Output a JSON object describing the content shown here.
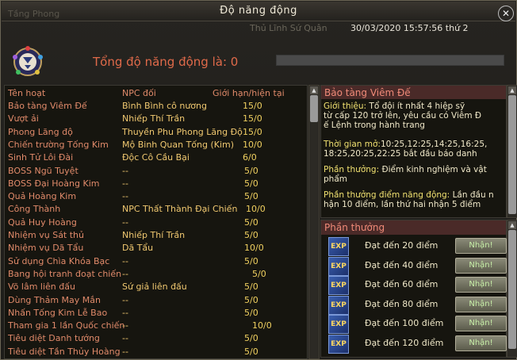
{
  "window": {
    "title": "Độ năng động",
    "ghost_left": "Tầng Phong",
    "ghost_right": "Thủ Lĩnh Sứ Quân",
    "datetime": "30/03/2020 15:57:56 thứ 2",
    "close_label": "✕"
  },
  "summary": {
    "total_label": "Tổng độ năng động là: 0",
    "progress": 0.0
  },
  "table": {
    "headers": [
      "Tên hoạt",
      "NPC đối",
      "Giới hạn/hiện tại"
    ],
    "rows": [
      {
        "name": "Bảo tàng Viêm Đế",
        "npc": "Bình Bình cô nương",
        "limit": "15/0"
      },
      {
        "name": "Vượt ải",
        "npc": "Nhiếp Thí Trần",
        "limit": "15/0"
      },
      {
        "name": "Phong Lăng độ",
        "npc": "Thuyền Phu Phong Lăng Độ",
        "limit": "15/0"
      },
      {
        "name": "Chiến trường Tống Kim",
        "npc": "Mộ Binh Quan Tống (Kim)",
        "limit": "10/0"
      },
      {
        "name": "Sinh Tử Lôi Đài",
        "npc": "Độc Cô Cầu Bại",
        "limit": "6/0"
      },
      {
        "name": "BOSS Ngũ Tuyệt",
        "npc": "--",
        "limit": "5/0"
      },
      {
        "name": "BOSS Đại Hoàng Kim",
        "npc": "--",
        "limit": "5/0"
      },
      {
        "name": "Quả Hoàng Kim",
        "npc": "--",
        "limit": "5/0"
      },
      {
        "name": "Công Thành",
        "npc": "NPC Thất Thành Đại Chiến",
        "limit": "10/0"
      },
      {
        "name": "Quả Huy Hoàng",
        "npc": "--",
        "limit": "5/0"
      },
      {
        "name": "Nhiệm vụ Sát thủ",
        "npc": "Nhiếp Thí Trần",
        "limit": "5/0"
      },
      {
        "name": "Nhiệm vụ Dã Tẩu",
        "npc": "Dã Tẩu",
        "limit": "10/0"
      },
      {
        "name": "Sử dụng Chìa Khóa Bạc",
        "npc": "--",
        "limit": "5/0"
      },
      {
        "name": "Bang hội tranh đoạt chiến",
        "npc": "--",
        "limit": "5/0"
      },
      {
        "name": "Võ lâm liên đấu",
        "npc": "Sứ giả liên đấu",
        "limit": "5/0"
      },
      {
        "name": "Dùng Thảm May Mắn",
        "npc": "--",
        "limit": "5/0"
      },
      {
        "name": "Nhấn Tống Kim Lễ Bao",
        "npc": "--",
        "limit": "5/0"
      },
      {
        "name": "Tham gia 1 lần Quốc chiến",
        "npc": "--",
        "limit": "10/0"
      },
      {
        "name": "Tiêu diệt Danh tướng",
        "npc": "--",
        "limit": "5/0"
      },
      {
        "name": "Tiêu diệt Tần Thủy Hoàng",
        "npc": "--",
        "limit": "5/0"
      }
    ]
  },
  "info": {
    "heading": "Bảo tàng Viêm Đế",
    "intro_label": "Giới thiệu:",
    "intro_text_1": " Tổ đội ít nhất 4 hiệp sỹ",
    "intro_text_2": "từ cấp 120 trở lên, yêu cầu có Viêm Đ",
    "intro_text_3": "ế Lệnh trong hành trang",
    "time_label": "Thời gian mở:",
    "time_text_1": "10:25,12:25,14:25,16:25,",
    "time_text_2": "18:25,20:25,22:25 bắt đầu báo danh",
    "reward_label": "Phần thưởng:",
    "reward_text_1": "  Điểm kinh nghiệm và vật",
    "reward_text_2": "phẩm",
    "points_label": "Phần thưởng điểm năng động:",
    "points_text_1": " Lần đầu n",
    "points_text_2": "hận 10 điểm, lần thứ hai nhận 5 điểm"
  },
  "rewards": {
    "heading": "Phần thưởng",
    "icon_text": "EXP",
    "items": [
      {
        "label": "Đạt đến 20 điểm",
        "button": "Nhận!"
      },
      {
        "label": "Đạt đến 40 điểm",
        "button": "Nhận!"
      },
      {
        "label": "Đạt đến 60 điểm",
        "button": "Nhận!"
      },
      {
        "label": "Đạt đến 80 điểm",
        "button": "Nhận!"
      },
      {
        "label": "Đạt đến 100 điểm",
        "button": "Nhận!"
      },
      {
        "label": "Đạt đến 120 điểm",
        "button": "Nhận!"
      }
    ]
  }
}
